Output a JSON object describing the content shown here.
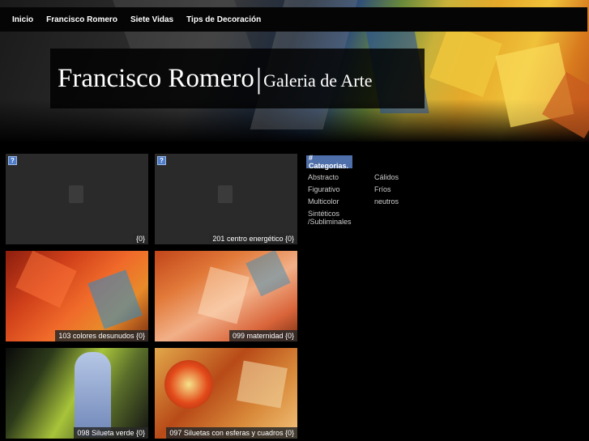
{
  "nav": {
    "items": [
      "Inicio",
      "Francisco Romero",
      "Siete Vidas",
      "Tips de Decoración"
    ]
  },
  "header": {
    "title": "Francisco Romero",
    "separator": "|",
    "subtitle": "Galeria de Arte"
  },
  "gallery": {
    "tiles": [
      {
        "caption": "{0}",
        "has_image": false
      },
      {
        "caption": "201 centro energético {0}",
        "has_image": false
      },
      {
        "caption": "103 colores desunudos {0}",
        "has_image": true
      },
      {
        "caption": "099 maternidad {0}",
        "has_image": true
      },
      {
        "caption": "098 Silueta verde {0}",
        "has_image": true
      },
      {
        "caption": "097 Siluetas con esferas y cuadros {0}",
        "has_image": true
      }
    ]
  },
  "sidebar": {
    "categories_title": "# Categorias.",
    "col1": [
      "Abstracto",
      "Figurativo",
      "Multicolor",
      "Sintéticos",
      "/Subliminales"
    ],
    "col2": [
      "Cálidos",
      "Fríos",
      "neutros"
    ]
  },
  "colors": {
    "accent": "#4f6fab",
    "background": "#000000"
  }
}
